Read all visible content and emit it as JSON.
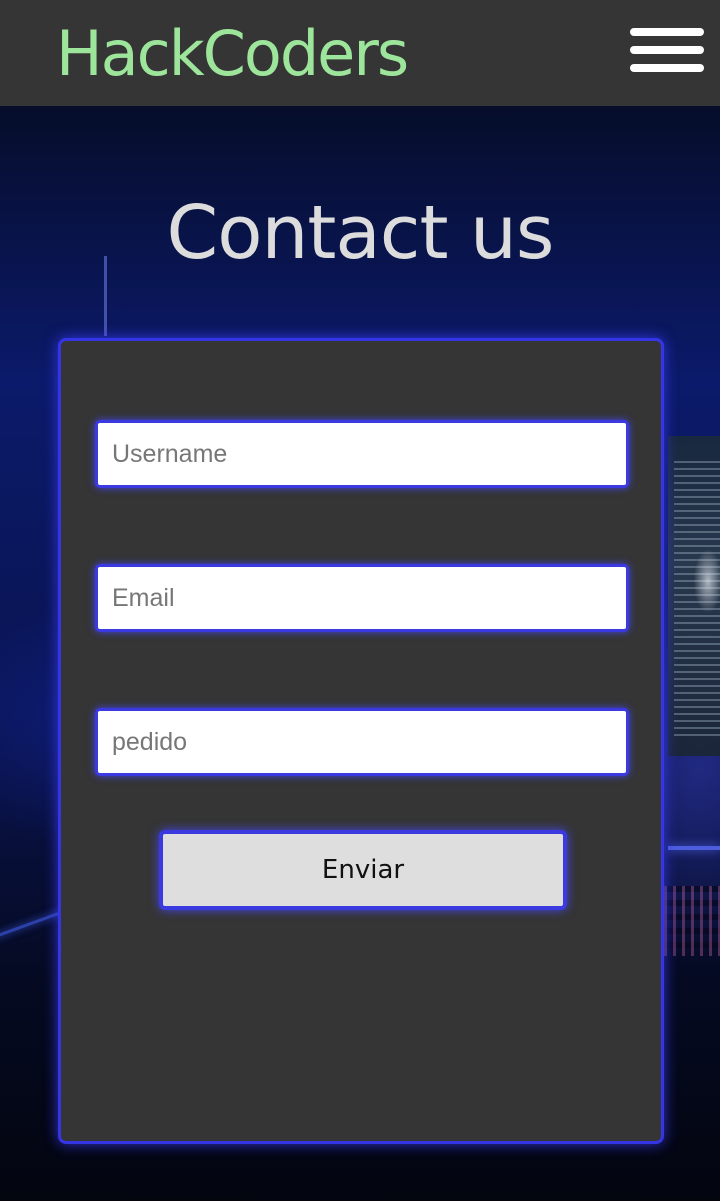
{
  "header": {
    "brand": "HackCoders",
    "menu_icon": "hamburger-menu-icon"
  },
  "page": {
    "title": "Contact us"
  },
  "form": {
    "username_placeholder": "Username",
    "email_placeholder": "Email",
    "request_placeholder": "pedido",
    "submit_label": "Enviar"
  },
  "colors": {
    "brand": "#9ee59c",
    "header_bg": "#353535",
    "card_bg": "#353535",
    "accent_border": "#3535e6",
    "title": "#dcdcdc",
    "button_bg": "#dedede"
  }
}
